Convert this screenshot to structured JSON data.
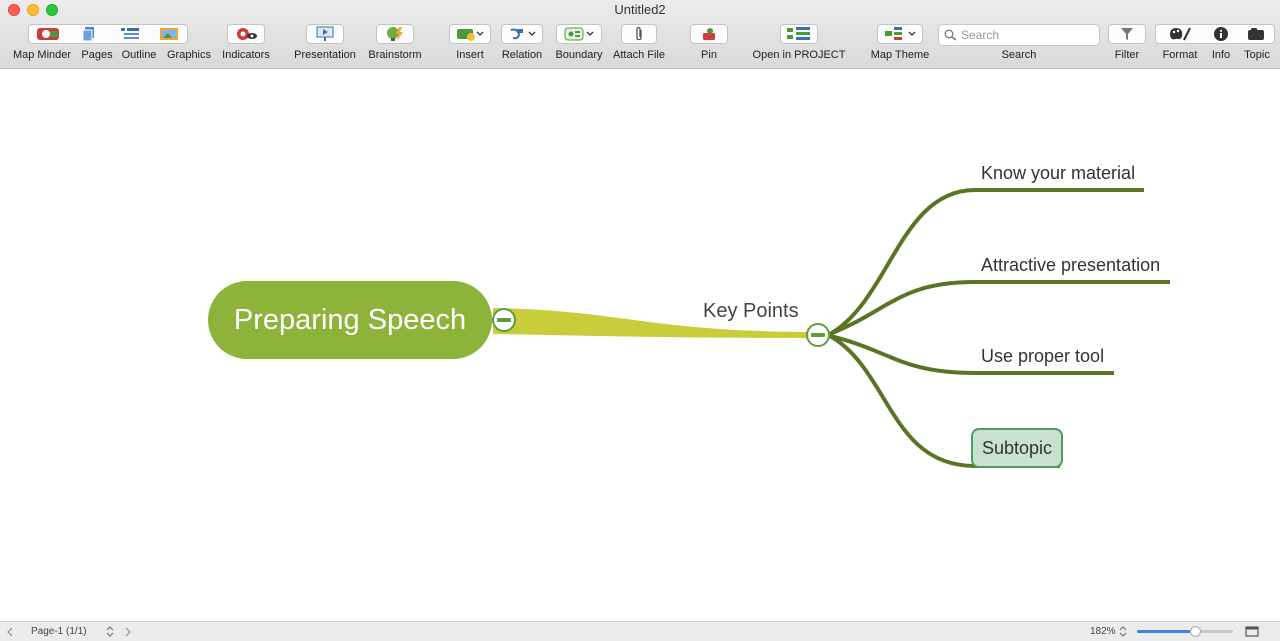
{
  "window": {
    "title": "Untitled2"
  },
  "toolbar": {
    "map_minder": "Map Minder",
    "pages": "Pages",
    "outline": "Outline",
    "graphics": "Graphics",
    "indicators": "Indicators",
    "presentation": "Presentation",
    "brainstorm": "Brainstorm",
    "insert": "Insert",
    "relation": "Relation",
    "boundary": "Boundary",
    "attach_file": "Attach File",
    "pin": "Pin",
    "open_in_project": "Open in PROJECT",
    "map_theme": "Map Theme",
    "search_label": "Search",
    "search_placeholder": "Search",
    "filter": "Filter",
    "format": "Format",
    "info": "Info",
    "topic": "Topic"
  },
  "map": {
    "central_topic": "Preparing Speech",
    "main_topic": "Key Points",
    "subtopics": [
      "Know your material",
      "Attractive presentation",
      "Use proper tool",
      "Subtopic"
    ]
  },
  "statusbar": {
    "page": "Page-1 (1/1)",
    "zoom": "182%",
    "zoom_fraction": 0.6
  },
  "colors": {
    "central": "#8db33a",
    "branch": "#c8cd3c",
    "subbranch": "#5b7424",
    "selected_fill": "#c8e2cf",
    "selected_border": "#4f9a5e"
  }
}
